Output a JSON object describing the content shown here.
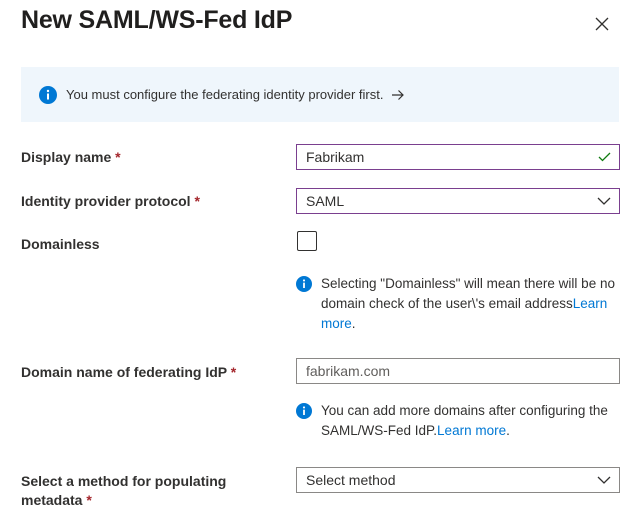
{
  "header": {
    "title": "New SAML/WS-Fed IdP"
  },
  "banner": {
    "text": "You must configure the federating identity provider first."
  },
  "form": {
    "required_mark": "*",
    "display_name": {
      "label": "Display name",
      "value": "Fabrikam"
    },
    "protocol": {
      "label": "Identity provider protocol",
      "value": "SAML"
    },
    "domainless": {
      "label": "Domainless",
      "checked": false,
      "note": "Selecting \"Domainless\" will mean there will be no domain check of the user\\'s email address",
      "note_link": "Learn more",
      "note_end": "."
    },
    "domain": {
      "label": "Domain name of federating IdP",
      "placeholder": "fabrikam.com",
      "note": "You can add more domains after configuring the SAML/WS-Fed IdP.",
      "note_link": "Learn more",
      "note_end": "."
    },
    "metadata": {
      "label_line1": "Select a method for populating",
      "label_line2": "metadata",
      "placeholder": "Select method"
    }
  },
  "colors": {
    "accent": "#0078d4",
    "required": "#a4262c",
    "valid": "#107c10",
    "banner_bg": "#eff6fc"
  }
}
